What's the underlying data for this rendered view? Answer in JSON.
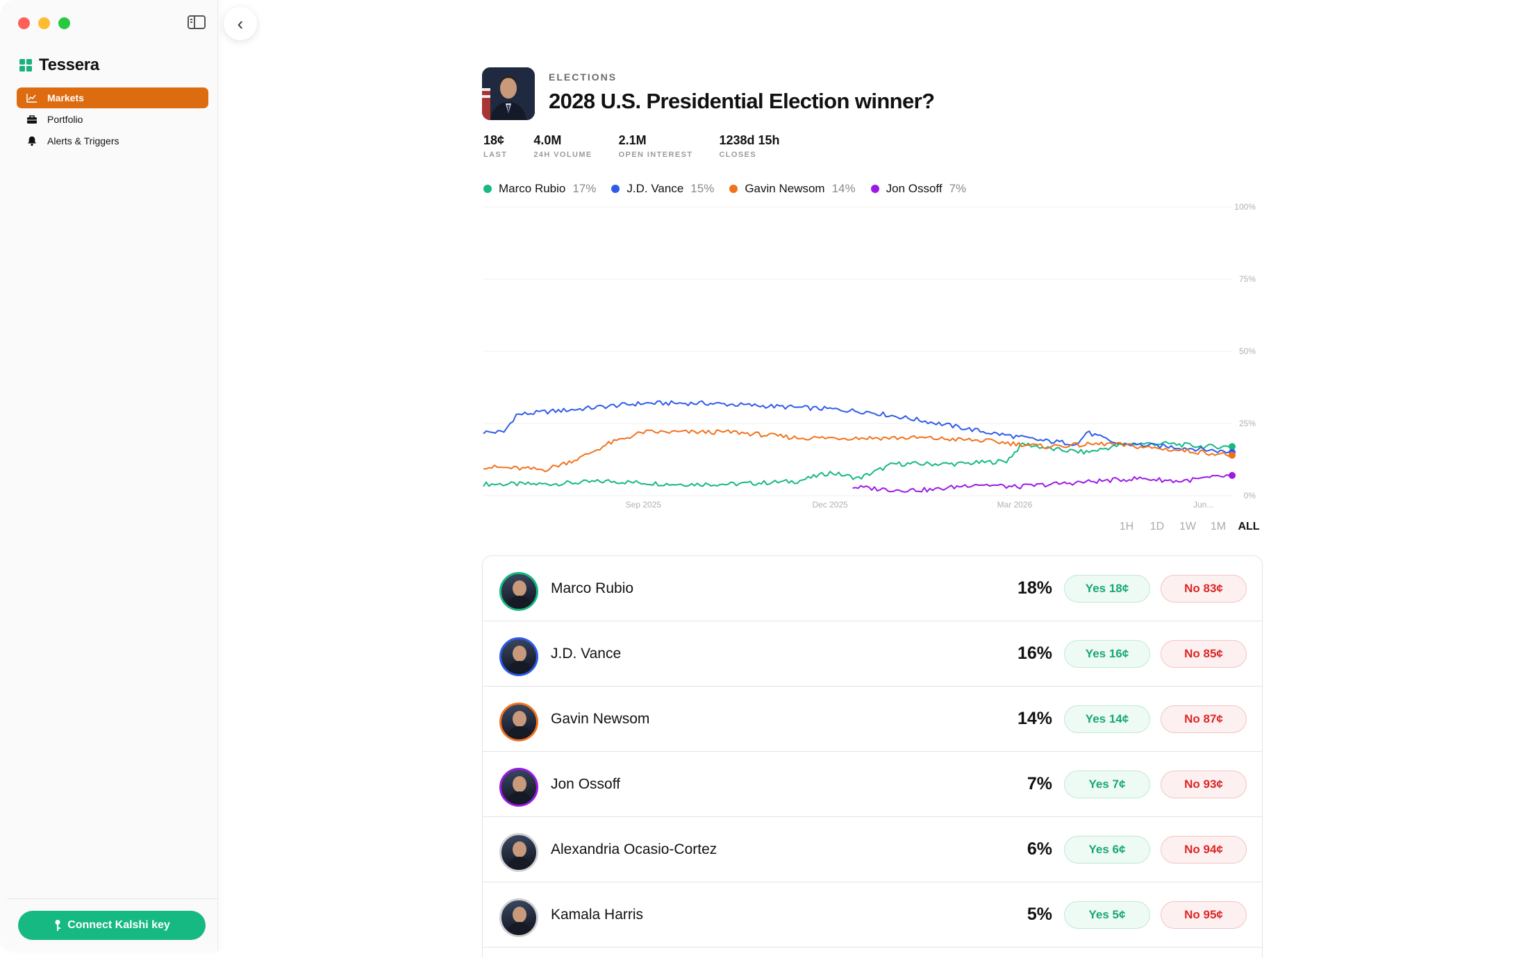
{
  "app": {
    "name": "Tessera"
  },
  "sidebar": {
    "items": [
      {
        "label": "Markets",
        "icon": "chart-icon",
        "active": true
      },
      {
        "label": "Portfolio",
        "icon": "briefcase-icon",
        "active": false
      },
      {
        "label": "Alerts & Triggers",
        "icon": "bell-icon",
        "active": false
      }
    ],
    "connect_label": "Connect Kalshi key"
  },
  "market": {
    "category": "ELECTIONS",
    "title": "2028 U.S. Presidential Election winner?",
    "stats": [
      {
        "value": "18¢",
        "label": "LAST"
      },
      {
        "value": "4.0M",
        "label": "24H VOLUME"
      },
      {
        "value": "2.1M",
        "label": "OPEN INTEREST"
      },
      {
        "value": "1238d 15h",
        "label": "CLOSES"
      }
    ]
  },
  "legend": [
    {
      "name": "Marco Rubio",
      "pct": "17%",
      "color": "#16b981"
    },
    {
      "name": "J.D. Vance",
      "pct": "15%",
      "color": "#2f5bea"
    },
    {
      "name": "Gavin Newsom",
      "pct": "14%",
      "color": "#f2711c"
    },
    {
      "name": "Jon Ossoff",
      "pct": "7%",
      "color": "#9b1ae6"
    }
  ],
  "chart_data": {
    "type": "line",
    "ylim": [
      0,
      100
    ],
    "y_ticks": [
      "100%",
      "75%",
      "50%",
      "25%",
      "0%"
    ],
    "x_ticks": [
      "Sep 2025",
      "Dec 2025",
      "Mar 2026",
      "Jun..."
    ],
    "x_range": [
      "2025-06-15",
      "2026-06-15"
    ],
    "grid": true,
    "series": [
      {
        "name": "Marco Rubio",
        "color": "#16b981",
        "points": [
          [
            "2025-06-15",
            4
          ],
          [
            "2025-07-15",
            4
          ],
          [
            "2025-08-15",
            5
          ],
          [
            "2025-09-15",
            4
          ],
          [
            "2025-10-15",
            4
          ],
          [
            "2025-11-15",
            5
          ],
          [
            "2025-12-01",
            8
          ],
          [
            "2025-12-15",
            6
          ],
          [
            "2026-01-01",
            11
          ],
          [
            "2026-02-01",
            11
          ],
          [
            "2026-02-25",
            12
          ],
          [
            "2026-03-05",
            18
          ],
          [
            "2026-03-20",
            16
          ],
          [
            "2026-04-05",
            15
          ],
          [
            "2026-04-25",
            18
          ],
          [
            "2026-05-15",
            18
          ],
          [
            "2026-06-01",
            17
          ],
          [
            "2026-06-15",
            17
          ]
        ]
      },
      {
        "name": "J.D. Vance",
        "color": "#2f5bea",
        "points": [
          [
            "2025-06-15",
            22
          ],
          [
            "2025-06-25",
            22
          ],
          [
            "2025-07-01",
            28
          ],
          [
            "2025-07-15",
            29
          ],
          [
            "2025-08-01",
            30
          ],
          [
            "2025-08-15",
            31
          ],
          [
            "2025-09-01",
            32
          ],
          [
            "2025-10-01",
            32
          ],
          [
            "2025-11-01",
            31
          ],
          [
            "2025-12-01",
            30
          ],
          [
            "2025-12-20",
            29
          ],
          [
            "2026-01-15",
            26
          ],
          [
            "2026-02-15",
            22
          ],
          [
            "2026-03-15",
            19
          ],
          [
            "2026-04-01",
            18
          ],
          [
            "2026-04-05",
            22
          ],
          [
            "2026-04-20",
            18
          ],
          [
            "2026-05-15",
            17
          ],
          [
            "2026-06-01",
            16
          ],
          [
            "2026-06-15",
            15
          ]
        ]
      },
      {
        "name": "Gavin Newsom",
        "color": "#f2711c",
        "points": [
          [
            "2025-06-15",
            10
          ],
          [
            "2025-07-15",
            9
          ],
          [
            "2025-08-01",
            13
          ],
          [
            "2025-08-15",
            18
          ],
          [
            "2025-09-01",
            22
          ],
          [
            "2025-09-15",
            22
          ],
          [
            "2025-10-15",
            22
          ],
          [
            "2025-11-15",
            20
          ],
          [
            "2025-12-15",
            20
          ],
          [
            "2026-01-15",
            20
          ],
          [
            "2026-02-15",
            19
          ],
          [
            "2026-03-15",
            17
          ],
          [
            "2026-04-15",
            18
          ],
          [
            "2026-05-15",
            16
          ],
          [
            "2026-06-01",
            15
          ],
          [
            "2026-06-15",
            14
          ]
        ]
      },
      {
        "name": "Jon Ossoff",
        "color": "#9b1ae6",
        "points": [
          [
            "2025-12-12",
            3
          ],
          [
            "2026-01-01",
            2
          ],
          [
            "2026-01-20",
            2
          ],
          [
            "2026-02-10",
            4
          ],
          [
            "2026-03-01",
            3
          ],
          [
            "2026-03-20",
            4
          ],
          [
            "2026-04-10",
            5
          ],
          [
            "2026-05-01",
            6
          ],
          [
            "2026-05-20",
            5
          ],
          [
            "2026-06-15",
            7
          ]
        ]
      }
    ]
  },
  "ranges": [
    {
      "label": "1H",
      "active": false
    },
    {
      "label": "1D",
      "active": false
    },
    {
      "label": "1W",
      "active": false
    },
    {
      "label": "1M",
      "active": false
    },
    {
      "label": "ALL",
      "active": true
    }
  ],
  "candidates": [
    {
      "name": "Marco Rubio",
      "pct": "18%",
      "yes": "Yes 18¢",
      "no": "No 83¢",
      "ring": "#16b981"
    },
    {
      "name": "J.D. Vance",
      "pct": "16%",
      "yes": "Yes 16¢",
      "no": "No 85¢",
      "ring": "#2f5bea"
    },
    {
      "name": "Gavin Newsom",
      "pct": "14%",
      "yes": "Yes 14¢",
      "no": "No 87¢",
      "ring": "#f2711c"
    },
    {
      "name": "Jon Ossoff",
      "pct": "7%",
      "yes": "Yes 7¢",
      "no": "No 93¢",
      "ring": "#9b1ae6"
    },
    {
      "name": "Alexandria Ocasio-Cortez",
      "pct": "6%",
      "yes": "Yes 6¢",
      "no": "No 94¢",
      "ring": "#d0d0d0"
    },
    {
      "name": "Kamala Harris",
      "pct": "5%",
      "yes": "Yes 5¢",
      "no": "No 95¢",
      "ring": "#d0d0d0"
    }
  ]
}
